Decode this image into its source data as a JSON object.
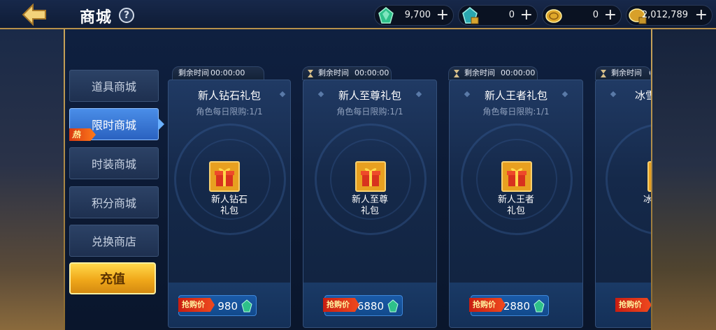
{
  "header": {
    "title": "商城",
    "help_label": "?"
  },
  "currencies": [
    {
      "icon": "green-gem-icon",
      "value": "9,700"
    },
    {
      "icon": "locked-gem-icon",
      "value": "0"
    },
    {
      "icon": "gold-coin-icon",
      "value": "0"
    },
    {
      "icon": "locked-gold-coin-icon",
      "value": "2,012,789"
    }
  ],
  "sidebar": {
    "items": [
      {
        "label": "道具商城",
        "active": false
      },
      {
        "label": "限时商城",
        "active": true,
        "badge": "热"
      },
      {
        "label": "时装商城",
        "active": false
      },
      {
        "label": "积分商城",
        "active": false
      },
      {
        "label": "兑换商店",
        "active": false
      }
    ],
    "recharge_label": "充值"
  },
  "cards": [
    {
      "timer_label": "剩余时间",
      "timer_value": "00:00:00",
      "timer_label_visible": "剩余时间",
      "title": "新人钻石礼包",
      "limit": "角色每日限购:1/1",
      "gift_name_line1": "新人钻石",
      "gift_name_line2": "礼包",
      "price_tag": "抢购价",
      "price": "980"
    },
    {
      "timer_label": "剩余时间",
      "timer_value": "00:00:00",
      "title": "新人至尊礼包",
      "limit": "角色每日限购:1/1",
      "gift_name_line1": "新人至尊",
      "gift_name_line2": "礼包",
      "price_tag": "抢购价",
      "price": "6880"
    },
    {
      "timer_label": "剩余时间",
      "timer_value": "00:00:00",
      "title": "新人王者礼包",
      "limit": "角色每日限购:1/1",
      "gift_name_line1": "新人王者",
      "gift_name_line2": "礼包",
      "price_tag": "抢购价",
      "price": "2880"
    },
    {
      "timer_label": "剩余时间",
      "timer_value": "0",
      "title": "冰雪",
      "gift_name_line1": "冰",
      "price_tag": "抢购价"
    }
  ],
  "colors": {
    "accent_gold": "#c9a45a",
    "active_tab": "#3a7ae0",
    "recharge": "#f0a81a"
  }
}
